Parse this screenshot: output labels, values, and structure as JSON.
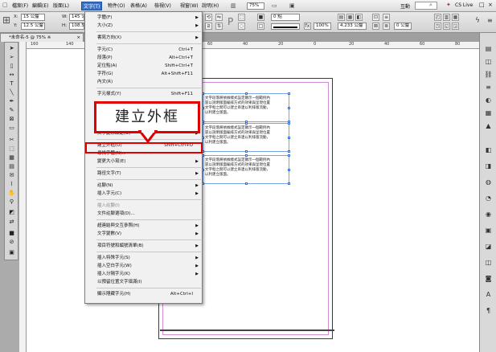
{
  "menubar": {
    "items": [
      "檔案(F)",
      "編輯(E)",
      "版面(L)",
      "文字(T)",
      "物件(O)",
      "表格(A)",
      "檢視(V)",
      "視窗(W)",
      "說明(H)"
    ],
    "zoom_field": "75%",
    "workspace": "互動",
    "search_placeholder": "",
    "cs_live": "CS Live"
  },
  "control": {
    "x_label": "X:",
    "x_value": "15 公釐",
    "y_label": "Y:",
    "y_value": "12.5 公釐",
    "w_label": "W:",
    "w_value": "145 公",
    "h_label": "H:",
    "h_value": "108.5",
    "stroke_value": "0 點",
    "percent_value": "100%",
    "gap_value": "4.233 公釐",
    "unit_value": "0 公釐"
  },
  "document": {
    "tab_title": "*未命名-5 @ 75% ※"
  },
  "ruler": {
    "ticks": [
      "160",
      "140",
      "120",
      "100",
      "80",
      "60",
      "40",
      "20",
      "0",
      "20",
      "40",
      "60",
      "80"
    ]
  },
  "frames": [
    {
      "lines": [
        "文字段落將依據樣式設定顯示一個範例內",
        "容以說明版面編排方式的效果與呈現位置",
        "文字框之間可以建立串連以利排版流動，",
        "以利建立版面。"
      ]
    },
    {
      "lines": [
        "文字段落將依據樣式設定顯示一個範例內",
        "容以說明版面編排方式的效果與呈現位置",
        "文字框之間可以建立串連以利排版流動，",
        "以利建立版面。"
      ]
    },
    {
      "lines": [
        "文字段落將依據樣式設定顯示一個範例內",
        "容以說明版面編排方式的效果與呈現位置",
        "文字框之間可以建立串連以利排版流動，",
        "以利建立版面。"
      ]
    }
  ],
  "menu": {
    "items": [
      {
        "label": "字體(F)",
        "shortcut": "",
        "arrow": true
      },
      {
        "label": "大小(Z)",
        "shortcut": "",
        "arrow": true
      },
      {
        "sep": true
      },
      {
        "label": "書寫方向(X)",
        "shortcut": "",
        "arrow": true
      },
      {
        "sep": true
      },
      {
        "label": "字元(C)",
        "shortcut": "Ctrl+T",
        "arrow": false
      },
      {
        "label": "段落(P)",
        "shortcut": "Alt+Ctrl+T",
        "arrow": false
      },
      {
        "label": "定位點(A)",
        "shortcut": "Shift+Ctrl+T",
        "arrow": false
      },
      {
        "label": "字符(G)",
        "shortcut": "Alt+Shift+F11",
        "arrow": false
      },
      {
        "label": "內文(R)",
        "shortcut": "",
        "arrow": false
      },
      {
        "sep": true
      },
      {
        "label": "字元樣式(Y)",
        "shortcut": "Shift+F11",
        "arrow": false
      },
      {
        "gap": true
      },
      {
        "gap": true
      },
      {
        "gap": true
      },
      {
        "gap": true
      },
      {
        "label": "文字變形設定(U)",
        "shortcut": "",
        "arrow": true
      },
      {
        "sep": true
      },
      {
        "label": "建立外框(O)",
        "shortcut": "Shift+Ctrl+O",
        "arrow": false,
        "highlight": true
      },
      {
        "label": "尋找字體(N)...",
        "shortcut": "",
        "arrow": false
      },
      {
        "label": "變更大小寫(E)",
        "shortcut": "",
        "arrow": true
      },
      {
        "sep": true
      },
      {
        "label": "路徑文字(T)",
        "shortcut": "",
        "arrow": true
      },
      {
        "sep": true
      },
      {
        "label": "註腳(N)",
        "shortcut": "",
        "arrow": true
      },
      {
        "label": "插入字元(C)",
        "shortcut": "",
        "arrow": true
      },
      {
        "sep": true
      },
      {
        "label": "插入註腳(I)",
        "shortcut": "",
        "arrow": false,
        "disabled": true
      },
      {
        "label": "文件註腳選項(D)...",
        "shortcut": "",
        "arrow": false
      },
      {
        "sep": true
      },
      {
        "label": "超連結與交互參照(H)",
        "shortcut": "",
        "arrow": true
      },
      {
        "label": "文字變數(V)",
        "shortcut": "",
        "arrow": true
      },
      {
        "sep": true
      },
      {
        "label": "項目符號和編號清單(B)",
        "shortcut": "",
        "arrow": true
      },
      {
        "sep": true
      },
      {
        "label": "插入特殊字元(S)",
        "shortcut": "",
        "arrow": true
      },
      {
        "label": "插入空白字元(W)",
        "shortcut": "",
        "arrow": true
      },
      {
        "label": "插入分隔字元(K)",
        "shortcut": "",
        "arrow": true
      },
      {
        "label": "以預留位置文字填滿(I)",
        "shortcut": "",
        "arrow": false
      },
      {
        "sep": true
      },
      {
        "label": "顯示隱藏字元(H)",
        "shortcut": "Alt+Ctrl+I",
        "arrow": false
      }
    ]
  },
  "callout": {
    "text": "建立外框"
  }
}
